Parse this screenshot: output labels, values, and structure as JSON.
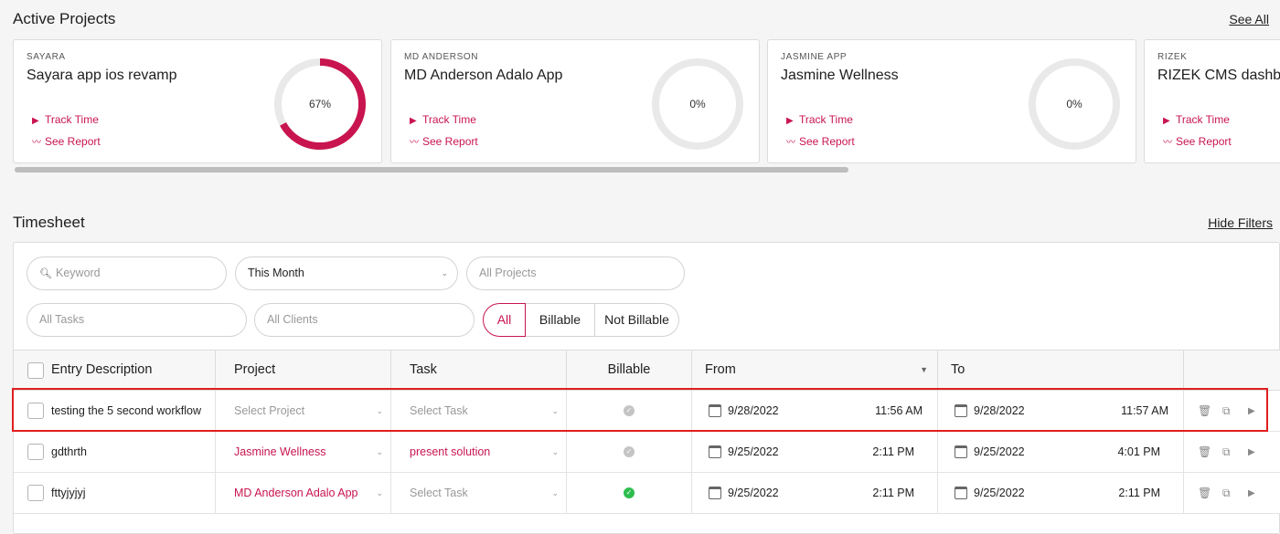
{
  "active_projects": {
    "title": "Active Projects",
    "see_all": "See All",
    "cards": [
      {
        "client": "SAYARA",
        "name": "Sayara app ios revamp",
        "progress_label": "67%",
        "progress": 0.67,
        "track_label": "Track Time",
        "report_label": "See Report"
      },
      {
        "client": "MD ANDERSON",
        "name": "MD Anderson Adalo App",
        "progress_label": "0%",
        "progress": 0,
        "track_label": "Track Time",
        "report_label": "See Report"
      },
      {
        "client": "JASMINE APP",
        "name": "Jasmine Wellness",
        "progress_label": "0%",
        "progress": 0,
        "track_label": "Track Time",
        "report_label": "See Report"
      },
      {
        "client": "RIZEK",
        "name": "RIZEK CMS dashb",
        "progress_label": "",
        "progress": 0,
        "track_label": "Track Time",
        "report_label": "See Report"
      }
    ]
  },
  "timesheet": {
    "title": "Timesheet",
    "hide_filters": "Hide Filters",
    "filters": {
      "keyword_placeholder": "Keyword",
      "period_value": "This Month",
      "projects_placeholder": "All Projects",
      "tasks_placeholder": "All Tasks",
      "clients_placeholder": "All Clients",
      "billing_options": [
        "All",
        "Billable",
        "Not Billable"
      ],
      "billing_selected": "All"
    },
    "columns": [
      "Entry Description",
      "Project",
      "Task",
      "Billable",
      "From",
      "To"
    ],
    "rows": [
      {
        "description": "testing the 5 second workflow",
        "project": "Select Project",
        "project_set": false,
        "task": "Select Task",
        "task_set": false,
        "billable": false,
        "from_date": "9/28/2022",
        "from_time": "11:56 AM",
        "to_date": "9/28/2022",
        "to_time": "11:57 AM"
      },
      {
        "description": "gdthrth",
        "project": "Jasmine Wellness",
        "project_set": true,
        "task": "present solution",
        "task_set": true,
        "billable": false,
        "from_date": "9/25/2022",
        "from_time": "2:11 PM",
        "to_date": "9/25/2022",
        "to_time": "4:01 PM"
      },
      {
        "description": "fttyjyjyj",
        "project": "MD Anderson Adalo App",
        "project_set": true,
        "task": "Select Task",
        "task_set": false,
        "billable": true,
        "from_date": "9/25/2022",
        "from_time": "2:11 PM",
        "to_date": "9/25/2022",
        "to_time": "2:11 PM"
      }
    ]
  },
  "colors": {
    "accent": "#c8154f",
    "highlight": "#e01f1f",
    "billable_on": "#2ebd4e",
    "billable_off": "#c4c4c4"
  }
}
